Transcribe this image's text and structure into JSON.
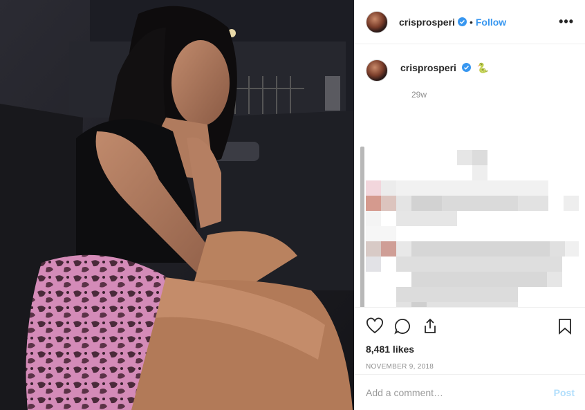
{
  "post": {
    "username": "crisprosperi",
    "follow_label": "Follow",
    "separator": "•",
    "more_label": "•••",
    "photo_alt": "Post photo"
  },
  "caption": {
    "username": "crisprosperi",
    "emoji": "🐍",
    "timestamp": "29w"
  },
  "actions": {
    "likes": "8,481 likes",
    "date": "NOVEMBER 9, 2018",
    "like_icon": "heart-icon",
    "comment_icon": "comment-icon",
    "share_icon": "share-icon",
    "save_icon": "bookmark-icon"
  },
  "comment_box": {
    "placeholder": "Add a comment…",
    "post_label": "Post"
  },
  "colors": {
    "accent": "#3897f0",
    "post_disabled": "#b2dffc",
    "secondary_text": "#8e8e8e"
  }
}
